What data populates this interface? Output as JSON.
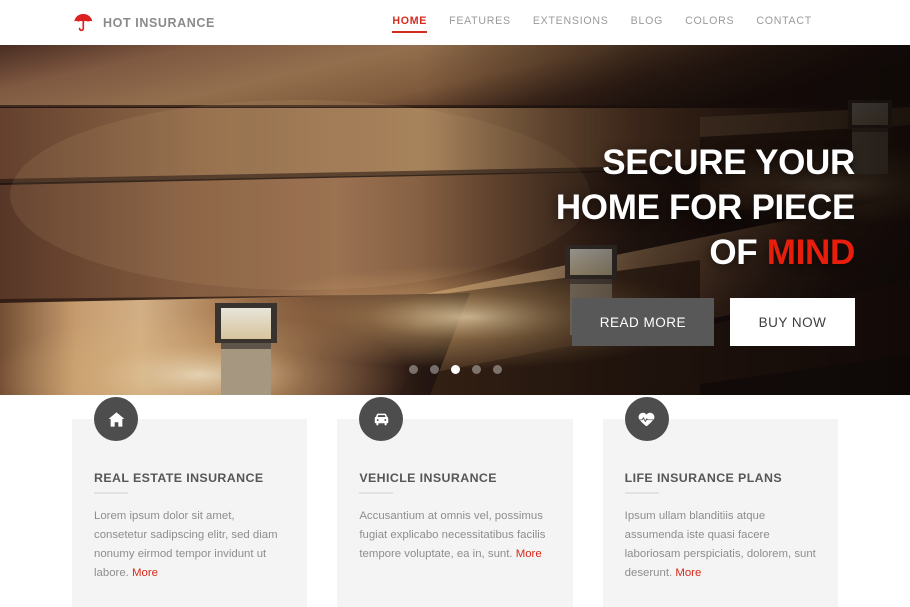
{
  "header": {
    "logo_icon": "umbrella-icon",
    "brand_name": "HOT INSURANCE",
    "nav": [
      {
        "label": "HOME",
        "active": true
      },
      {
        "label": "FEATURES",
        "active": false
      },
      {
        "label": "EXTENSIONS",
        "active": false
      },
      {
        "label": "BLOG",
        "active": false
      },
      {
        "label": "COLORS",
        "active": false
      },
      {
        "label": "CONTACT",
        "active": false
      }
    ]
  },
  "hero": {
    "headline_line1": "SECURE YOUR",
    "headline_line2": "HOME FOR PIECE",
    "headline_line3_prefix": "OF ",
    "headline_line3_accent": "MIND",
    "buttons": {
      "read_more": "READ MORE",
      "buy_now": "BUY NOW"
    },
    "slider": {
      "total_slides": 5,
      "active_slide": 3
    },
    "image_description": "Dark concrete steps lit by three warm outdoor bollard lights"
  },
  "features": [
    {
      "icon": "home-icon",
      "title": "REAL ESTATE INSURANCE",
      "text": "Lorem ipsum dolor sit amet, consetetur sadipscing elitr, sed diam nonumy eirmod tempor invidunt ut labore. ",
      "more_label": "More"
    },
    {
      "icon": "car-icon",
      "title": "VEHICLE INSURANCE",
      "text": "Accusantium at omnis vel, possimus fugiat explicabo necessitatibus facilis tempore voluptate, ea in, sunt. ",
      "more_label": "More"
    },
    {
      "icon": "heartbeat-icon",
      "title": "LIFE INSURANCE PLANS",
      "text": "Ipsum ullam blanditiis atque assumenda iste quasi facere laboriosam perspiciatis, dolorem, sunt deserunt. ",
      "more_label": "More"
    }
  ],
  "colors": {
    "accent_red": "#d42b1e",
    "hero_accent": "#e81e0c",
    "icon_circle": "#4d4d4d",
    "card_bg": "#f4f4f4",
    "nav_text": "#9b9b9b",
    "button_read": "#585858"
  }
}
